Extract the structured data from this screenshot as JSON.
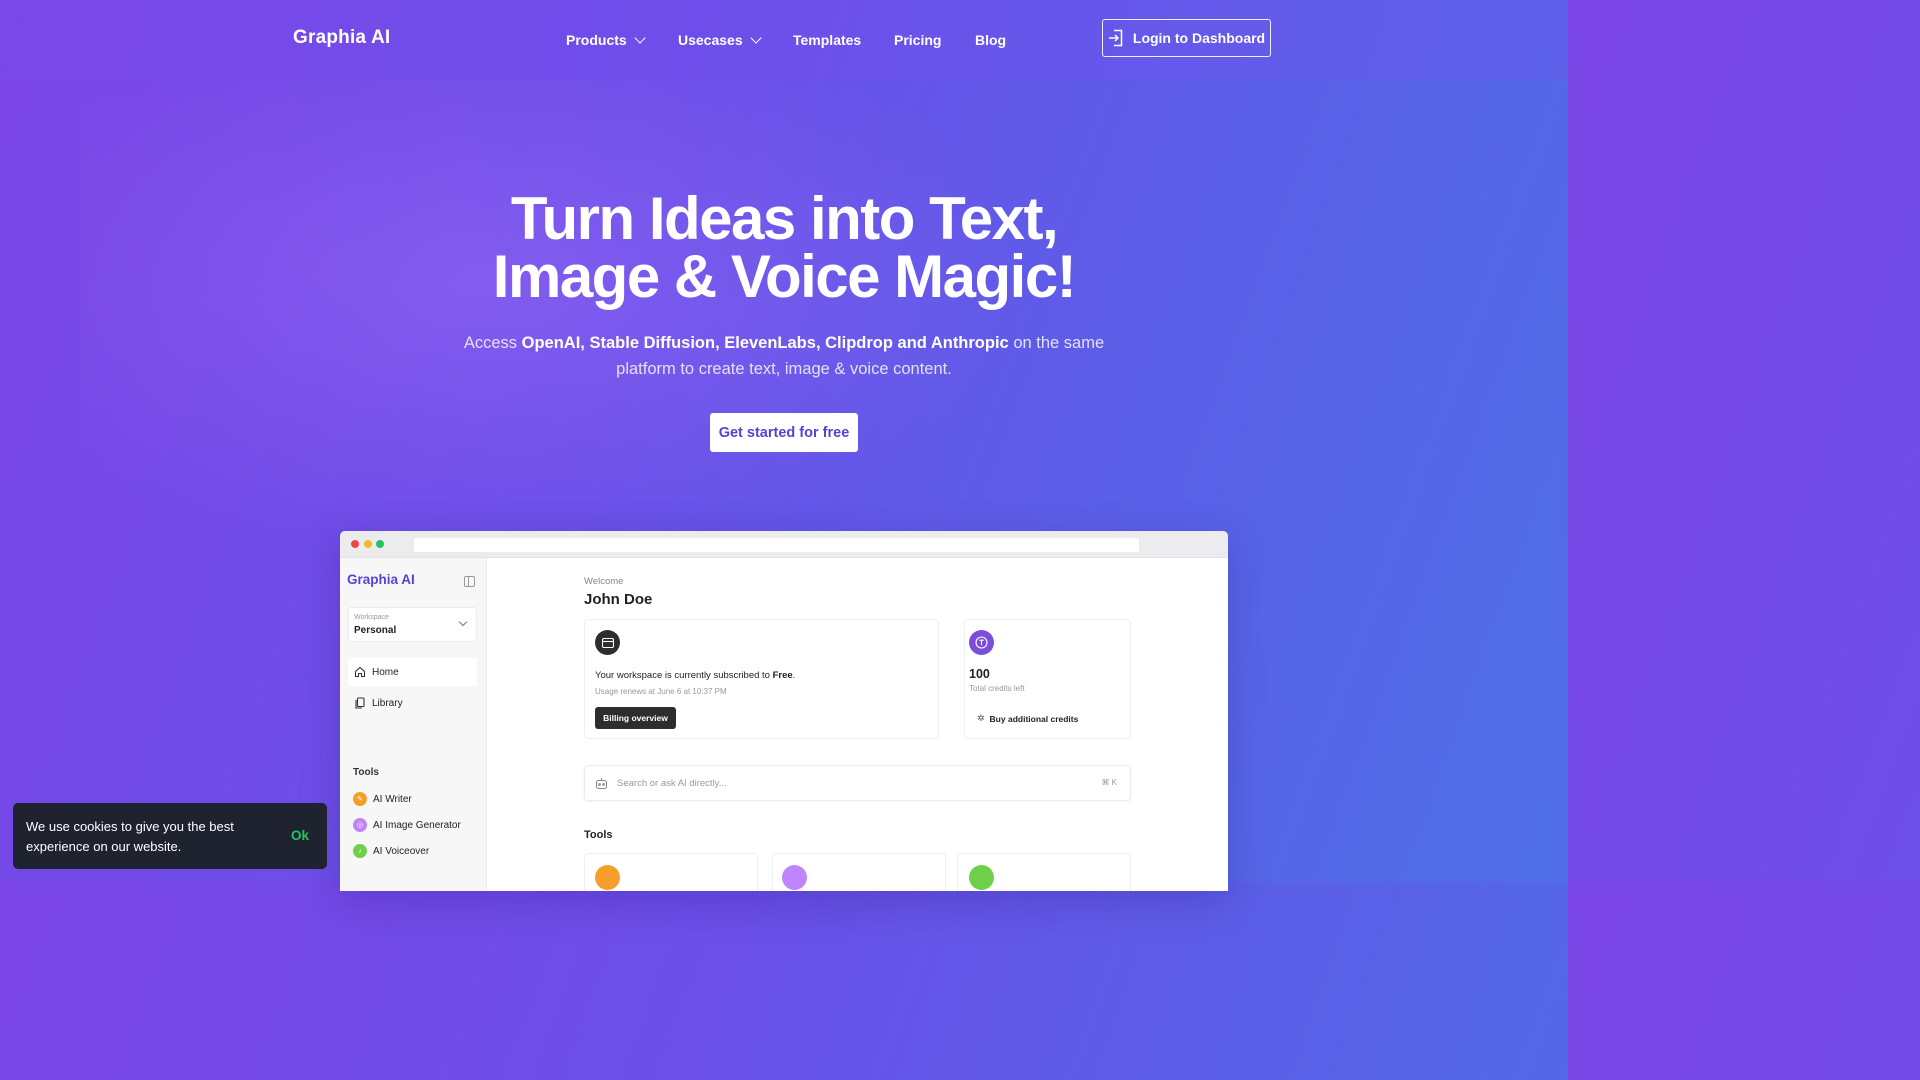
{
  "nav": {
    "logo": "Graphia AI",
    "items": [
      {
        "label": "Products",
        "has_dropdown": true
      },
      {
        "label": "Usecases",
        "has_dropdown": true
      },
      {
        "label": "Templates",
        "has_dropdown": false
      },
      {
        "label": "Pricing",
        "has_dropdown": false
      },
      {
        "label": "Blog",
        "has_dropdown": false
      }
    ],
    "login_label": "Login to Dashboard",
    "login_icon": "login-icon"
  },
  "hero": {
    "title_line1": "Turn Ideas into Text,",
    "title_line2": "Image & Voice Magic!",
    "sub_prefix": "Access ",
    "sub_bold": "OpenAI, Stable Diffusion, ElevenLabs, Clipdrop and Anthropic",
    "sub_suffix": " on the same platform to create text, image & voice content.",
    "cta_label": "Get started for free"
  },
  "mockup": {
    "sidebar": {
      "logo": "Graphia AI",
      "workspace_label": "Workspace",
      "workspace_value": "Personal",
      "items": [
        {
          "label": "Home",
          "icon": "home-icon"
        },
        {
          "label": "Library",
          "icon": "library-icon"
        }
      ],
      "tools_heading": "Tools",
      "tools": [
        {
          "label": "AI Writer",
          "color": "#f59e2a"
        },
        {
          "label": "AI Image Generator",
          "color": "#c084fc"
        },
        {
          "label": "AI Voiceover",
          "color": "#6ecf4a"
        }
      ]
    },
    "main": {
      "welcome": "Welcome",
      "name": "John Doe",
      "subscription_prefix": "Your workspace is currently subscribed to ",
      "subscription_plan": "Free",
      "subscription_suffix": ".",
      "renewal": "Usage renews at June 6 at 10:37 PM",
      "billing_button": "Billing overview",
      "credits_value": "100",
      "credits_label": "Total credits left",
      "buy_credits": "Buy additional credits",
      "search_placeholder": "Search or ask AI directly...",
      "search_shortcut": "⌘ K",
      "tools_heading": "Tools"
    }
  },
  "cookie": {
    "text": "We use cookies to give you the best experience on our website.",
    "ok": "Ok"
  },
  "colors": {
    "brand_purple": "#5b3fd2",
    "ok_green": "#22c55e",
    "credits_purple": "#7c4ddb"
  }
}
